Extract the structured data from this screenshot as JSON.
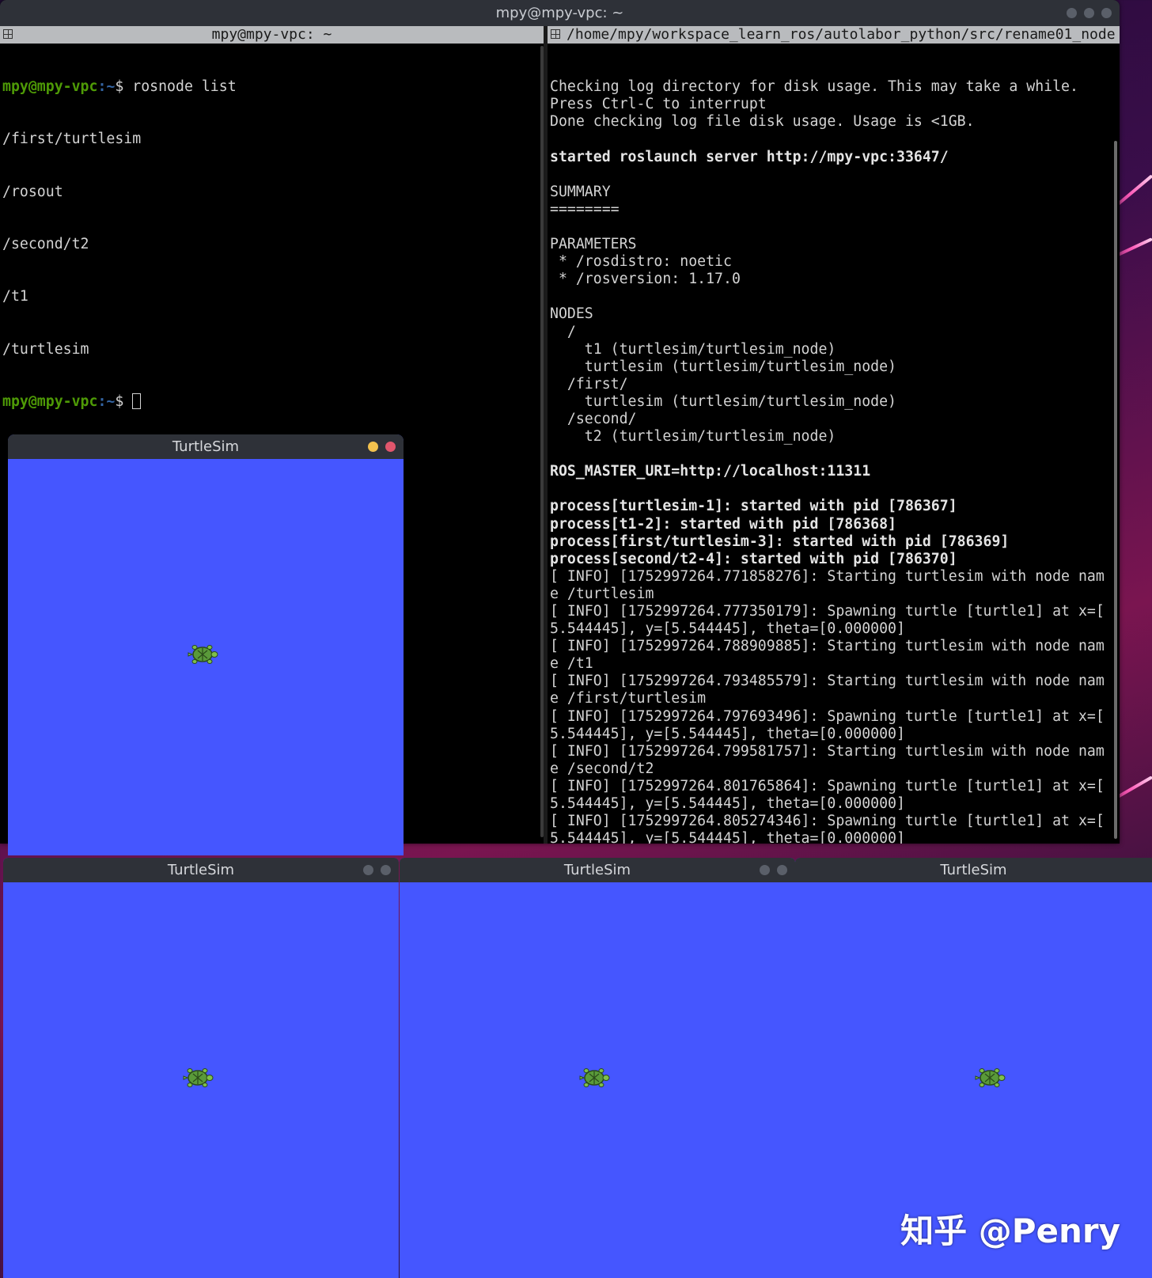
{
  "terminal": {
    "window_title": "mpy@mpy-vpc: ~",
    "left_pane": {
      "header": "mpy@mpy-vpc: ~",
      "prompt_user": "mpy@mpy-vpc",
      "prompt_path": ":~",
      "prompt_symbol": "$",
      "command": " rosnode list",
      "output": [
        "/first/turtlesim",
        "/rosout",
        "/second/t2",
        "/t1",
        "/turtlesim"
      ]
    },
    "right_pane": {
      "header": "/home/mpy/workspace_learn_ros/autolabor_python/src/rename01_node",
      "lines": [
        {
          "text": "Checking log directory for disk usage. This may take a while.",
          "bold": false
        },
        {
          "text": "Press Ctrl-C to interrupt",
          "bold": false
        },
        {
          "text": "Done checking log file disk usage. Usage is <1GB.",
          "bold": false
        },
        {
          "text": "",
          "bold": false
        },
        {
          "text": "started roslaunch server http://mpy-vpc:33647/",
          "bold": true
        },
        {
          "text": "",
          "bold": false
        },
        {
          "text": "SUMMARY",
          "bold": false
        },
        {
          "text": "========",
          "bold": false
        },
        {
          "text": "",
          "bold": false
        },
        {
          "text": "PARAMETERS",
          "bold": false
        },
        {
          "text": " * /rosdistro: noetic",
          "bold": false
        },
        {
          "text": " * /rosversion: 1.17.0",
          "bold": false
        },
        {
          "text": "",
          "bold": false
        },
        {
          "text": "NODES",
          "bold": false
        },
        {
          "text": "  /",
          "bold": false
        },
        {
          "text": "    t1 (turtlesim/turtlesim_node)",
          "bold": false
        },
        {
          "text": "    turtlesim (turtlesim/turtlesim_node)",
          "bold": false
        },
        {
          "text": "  /first/",
          "bold": false
        },
        {
          "text": "    turtlesim (turtlesim/turtlesim_node)",
          "bold": false
        },
        {
          "text": "  /second/",
          "bold": false
        },
        {
          "text": "    t2 (turtlesim/turtlesim_node)",
          "bold": false
        },
        {
          "text": "",
          "bold": false
        },
        {
          "text": "ROS_MASTER_URI=http://localhost:11311",
          "bold": true
        },
        {
          "text": "",
          "bold": false
        },
        {
          "text": "process[turtlesim-1]: started with pid [786367]",
          "bold": true
        },
        {
          "text": "process[t1-2]: started with pid [786368]",
          "bold": true
        },
        {
          "text": "process[first/turtlesim-3]: started with pid [786369]",
          "bold": true
        },
        {
          "text": "process[second/t2-4]: started with pid [786370]",
          "bold": true
        },
        {
          "text": "[ INFO] [1752997264.771858276]: Starting turtlesim with node nam",
          "bold": false
        },
        {
          "text": "e /turtlesim",
          "bold": false
        },
        {
          "text": "[ INFO] [1752997264.777350179]: Spawning turtle [turtle1] at x=[",
          "bold": false
        },
        {
          "text": "5.544445], y=[5.544445], theta=[0.000000]",
          "bold": false
        },
        {
          "text": "[ INFO] [1752997264.788909885]: Starting turtlesim with node nam",
          "bold": false
        },
        {
          "text": "e /t1",
          "bold": false
        },
        {
          "text": "[ INFO] [1752997264.793485579]: Starting turtlesim with node nam",
          "bold": false
        },
        {
          "text": "e /first/turtlesim",
          "bold": false
        },
        {
          "text": "[ INFO] [1752997264.797693496]: Spawning turtle [turtle1] at x=[",
          "bold": false
        },
        {
          "text": "5.544445], y=[5.544445], theta=[0.000000]",
          "bold": false
        },
        {
          "text": "[ INFO] [1752997264.799581757]: Starting turtlesim with node nam",
          "bold": false
        },
        {
          "text": "e /second/t2",
          "bold": false
        },
        {
          "text": "[ INFO] [1752997264.801765864]: Spawning turtle [turtle1] at x=[",
          "bold": false
        },
        {
          "text": "5.544445], y=[5.544445], theta=[0.000000]",
          "bold": false
        },
        {
          "text": "[ INFO] [1752997264.805274346]: Spawning turtle [turtle1] at x=[",
          "bold": false
        },
        {
          "text": "5.544445], y=[5.544445], theta=[0.000000]",
          "bold": false
        }
      ]
    }
  },
  "turtlesim_windows": [
    {
      "title": "TurtleSim",
      "focused": true
    },
    {
      "title": "TurtleSim",
      "focused": false
    },
    {
      "title": "TurtleSim",
      "focused": false
    },
    {
      "title": "TurtleSim",
      "focused": false
    }
  ],
  "watermark": "知乎 @Penry",
  "colors": {
    "turtlesim_background": "#4556ff",
    "prompt_user": "#4e9a06",
    "prompt_path": "#3465a4",
    "terminal_background": "#000000"
  }
}
